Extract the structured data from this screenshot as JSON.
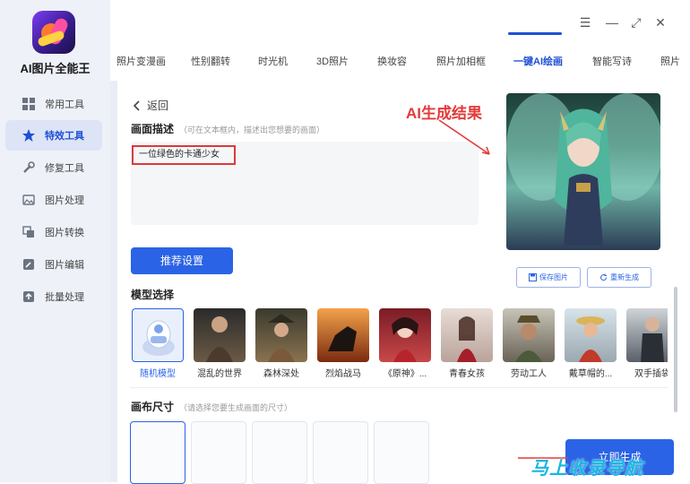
{
  "app": {
    "name": "AI图片全能王"
  },
  "window_controls": {
    "menu": "☰",
    "minimize": "—",
    "maximize": "⤢",
    "close": "✕"
  },
  "sidebar": {
    "items": [
      {
        "label": "常用工具",
        "icon": "grid-icon",
        "active": false
      },
      {
        "label": "特效工具",
        "icon": "star-icon",
        "active": true
      },
      {
        "label": "修复工具",
        "icon": "wrench-icon",
        "active": false
      },
      {
        "label": "图片处理",
        "icon": "image-icon",
        "active": false
      },
      {
        "label": "图片转换",
        "icon": "convert-icon",
        "active": false
      },
      {
        "label": "图片编辑",
        "icon": "edit-icon",
        "active": false
      },
      {
        "label": "批量处理",
        "icon": "batch-icon",
        "active": false
      }
    ]
  },
  "tabs": [
    {
      "label": "照片变漫画",
      "active": false
    },
    {
      "label": "性别翻转",
      "active": false
    },
    {
      "label": "时光机",
      "active": false
    },
    {
      "label": "3D照片",
      "active": false
    },
    {
      "label": "换妆容",
      "active": false
    },
    {
      "label": "照片加相框",
      "active": false
    },
    {
      "label": "一键AI绘画",
      "active": true
    },
    {
      "label": "智能写诗",
      "active": false
    },
    {
      "label": "照片",
      "active": false
    }
  ],
  "content": {
    "back_label": "返回",
    "description_title": "画面描述",
    "description_hint": "（可在文本框内，描述出您想要的画面）",
    "prompt_text": "一位绿色的卡通少女",
    "recommend_button": "推荐设置",
    "model_title": "模型选择",
    "models": [
      {
        "label": "随机模型",
        "active": true
      },
      {
        "label": "混乱的世界",
        "active": false
      },
      {
        "label": "森林深处",
        "active": false
      },
      {
        "label": "烈焰战马",
        "active": false
      },
      {
        "label": "《原神》...",
        "active": false
      },
      {
        "label": "青春女孩",
        "active": false
      },
      {
        "label": "劳动工人",
        "active": false
      },
      {
        "label": "戴草帽的...",
        "active": false
      },
      {
        "label": "双手插袋",
        "active": false
      }
    ],
    "canvas_title": "画布尺寸",
    "canvas_hint": "（请选择您要生成画面的尺寸）",
    "save_image_button": "保存图片",
    "regenerate_button": "重新生成",
    "generate_button": "立即生成",
    "annotation": "AI生成结果"
  },
  "watermark": "马上收录导航",
  "colors": {
    "accent": "#2a63e6",
    "annotation": "#e33a3a",
    "sidebar_bg": "#eef1f8"
  }
}
